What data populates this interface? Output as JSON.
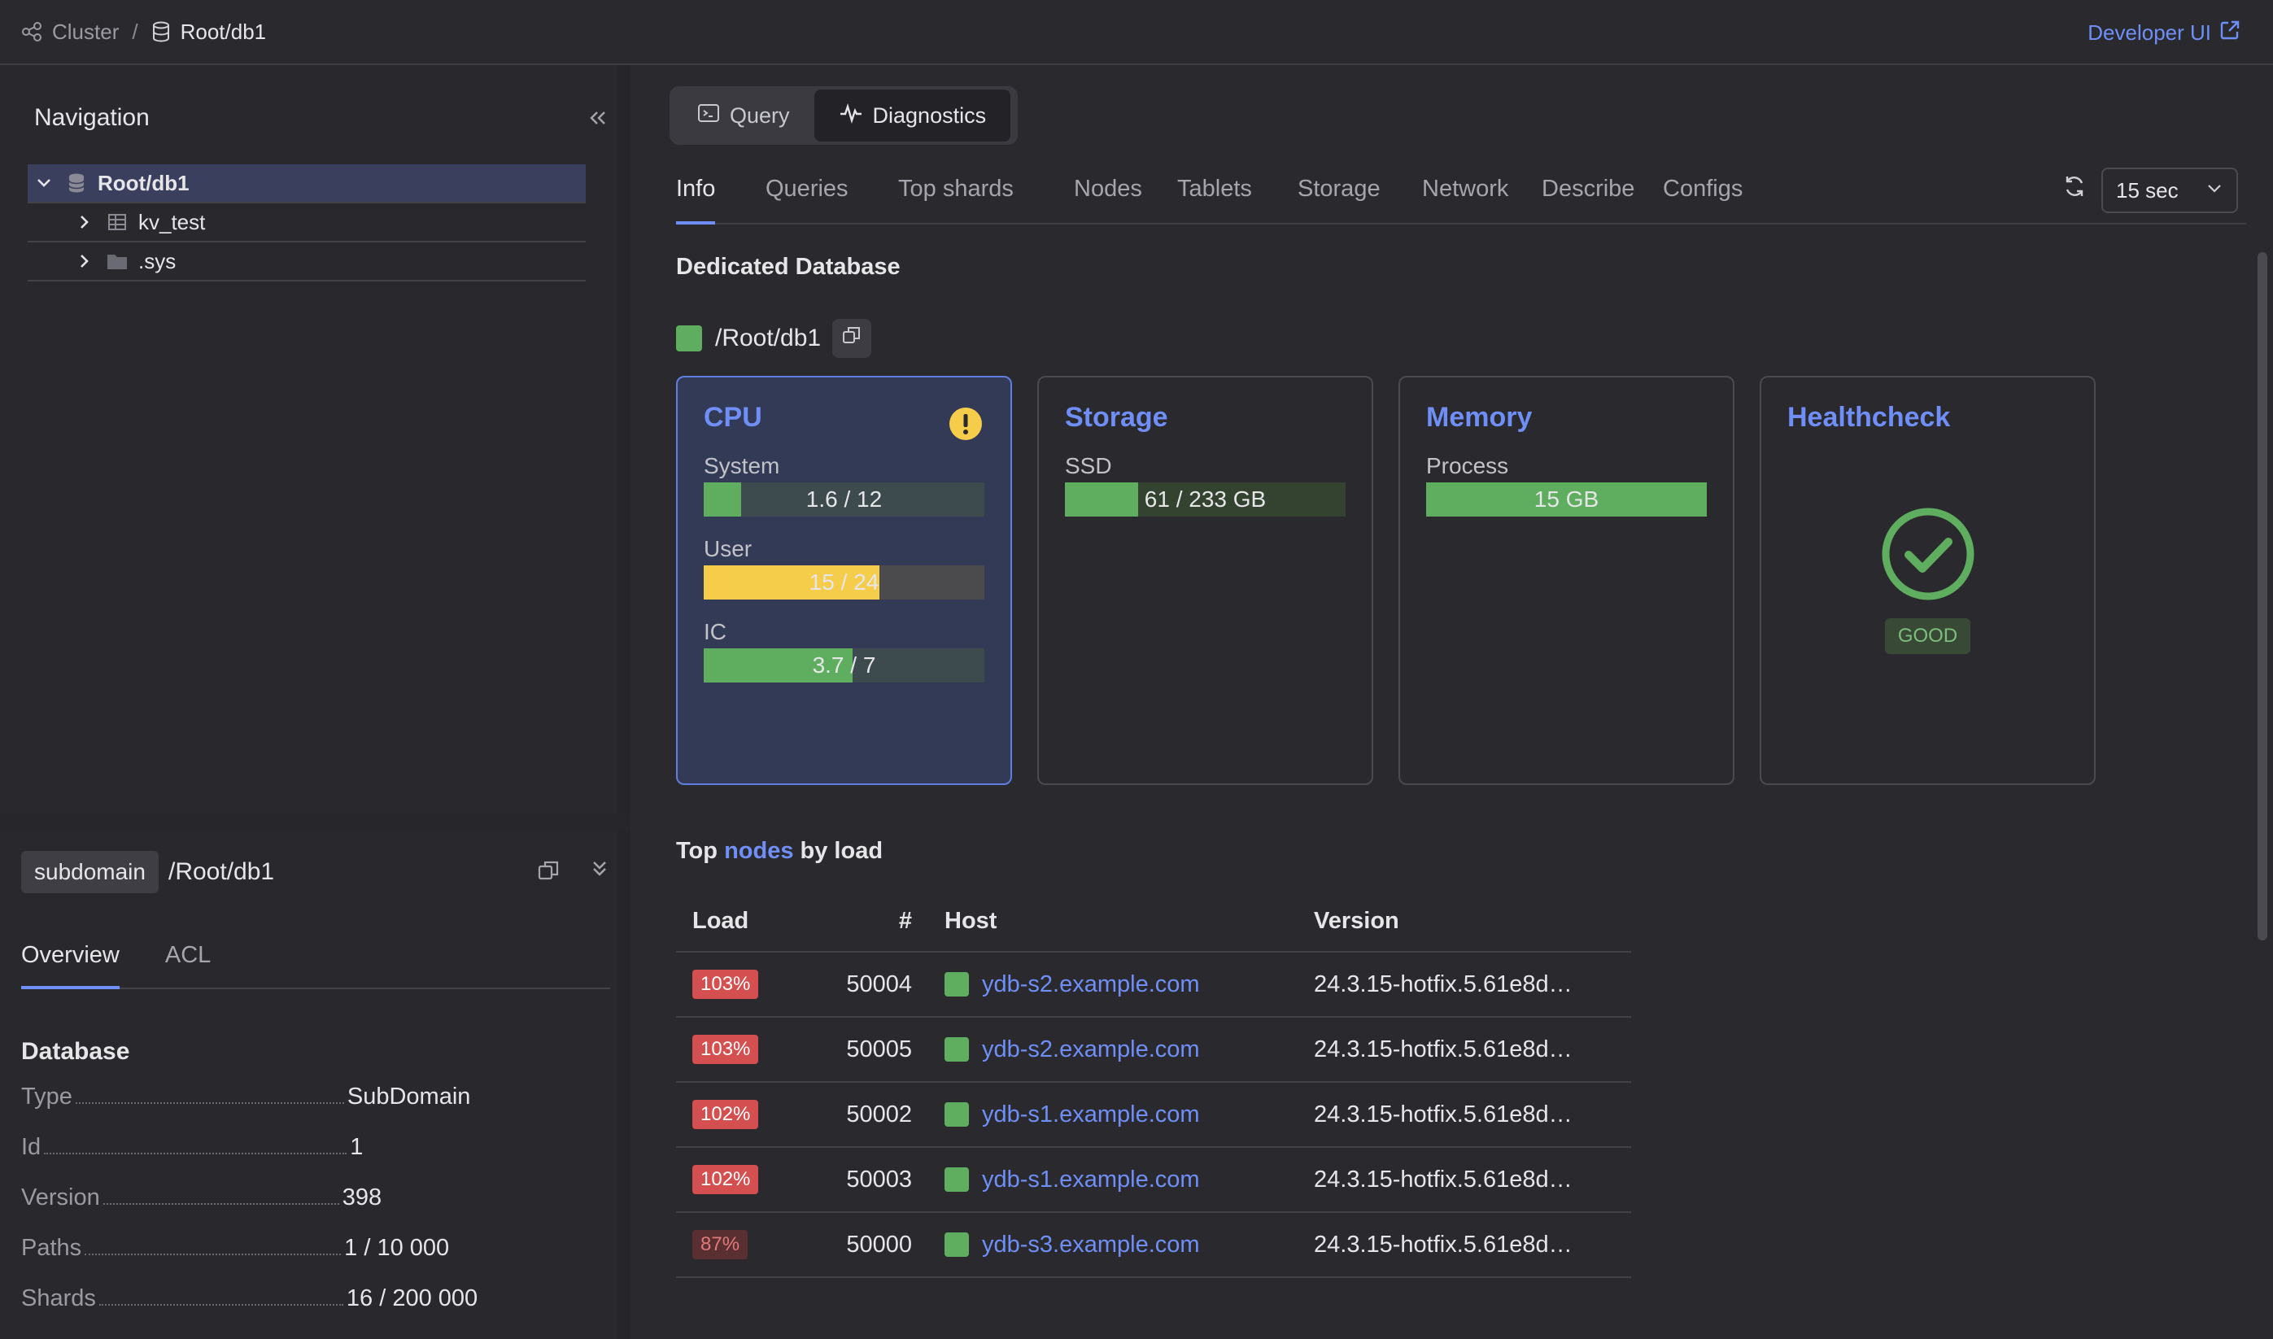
{
  "header": {
    "breadcrumb": {
      "cluster": "Cluster",
      "separator": "/",
      "database": "Root/db1"
    },
    "developer_link": "Developer UI"
  },
  "navigation": {
    "title": "Navigation",
    "tree": [
      {
        "label": "Root/db1",
        "icon": "database-icon",
        "expanded": true,
        "selected": true
      },
      {
        "label": "kv_test",
        "icon": "table-icon",
        "expanded": false
      },
      {
        "label": ".sys",
        "icon": "folder-icon",
        "expanded": false
      }
    ]
  },
  "object": {
    "type_badge": "subdomain",
    "path": "/Root/db1",
    "tabs": [
      "Overview",
      "ACL"
    ],
    "active_tab": "Overview",
    "section_title": "Database",
    "properties": [
      {
        "key": "Type",
        "value": "SubDomain"
      },
      {
        "key": "Id",
        "value": "1"
      },
      {
        "key": "Version",
        "value": "398"
      },
      {
        "key": "Paths",
        "value": "1 / 10 000"
      },
      {
        "key": "Shards",
        "value": "16 / 200 000"
      }
    ]
  },
  "mode_switch": {
    "query": "Query",
    "diagnostics": "Diagnostics",
    "active": "Diagnostics"
  },
  "tabs": [
    "Info",
    "Queries",
    "Top shards",
    "Nodes",
    "Tablets",
    "Storage",
    "Network",
    "Describe",
    "Configs"
  ],
  "active_tab": "Info",
  "refresh_interval": "15 sec",
  "info": {
    "title": "Dedicated Database",
    "path": "/Root/db1",
    "status_color": "#5fae5f",
    "cards": {
      "cpu": {
        "title": "CPU",
        "warning": true,
        "metrics": [
          {
            "label": "System",
            "text": "1.6 / 12",
            "fraction": 0.133,
            "color": "#5fae5f"
          },
          {
            "label": "User",
            "text": "15 / 24",
            "fraction": 0.625,
            "color": "#f5cd4a"
          },
          {
            "label": "IC",
            "text": "3.7 / 7",
            "fraction": 0.53,
            "color": "#5fae5f"
          }
        ]
      },
      "storage": {
        "title": "Storage",
        "metrics": [
          {
            "label": "SSD",
            "text": "61 / 233 GB",
            "fraction": 0.262,
            "color": "#5fae5f"
          }
        ]
      },
      "memory": {
        "title": "Memory",
        "metrics": [
          {
            "label": "Process",
            "text": "15 GB",
            "fraction": 1.0,
            "color": "#5fae5f"
          }
        ]
      },
      "health": {
        "title": "Healthcheck",
        "status": "GOOD"
      }
    }
  },
  "top_nodes": {
    "title_prefix": "Top",
    "title_link": "nodes",
    "title_suffix": "by load",
    "columns": {
      "load": "Load",
      "num": "#",
      "host": "Host",
      "version": "Version"
    },
    "rows": [
      {
        "load": "103%",
        "severity": "high",
        "num": "50004",
        "host": "ydb-s2.example.com",
        "version": "24.3.15-hotfix.5.61e8d…"
      },
      {
        "load": "103%",
        "severity": "high",
        "num": "50005",
        "host": "ydb-s2.example.com",
        "version": "24.3.15-hotfix.5.61e8d…"
      },
      {
        "load": "102%",
        "severity": "high",
        "num": "50002",
        "host": "ydb-s1.example.com",
        "version": "24.3.15-hotfix.5.61e8d…"
      },
      {
        "load": "102%",
        "severity": "high",
        "num": "50003",
        "host": "ydb-s1.example.com",
        "version": "24.3.15-hotfix.5.61e8d…"
      },
      {
        "load": "87%",
        "severity": "mid",
        "num": "50000",
        "host": "ydb-s3.example.com",
        "version": "24.3.15-hotfix.5.61e8d…"
      }
    ]
  }
}
